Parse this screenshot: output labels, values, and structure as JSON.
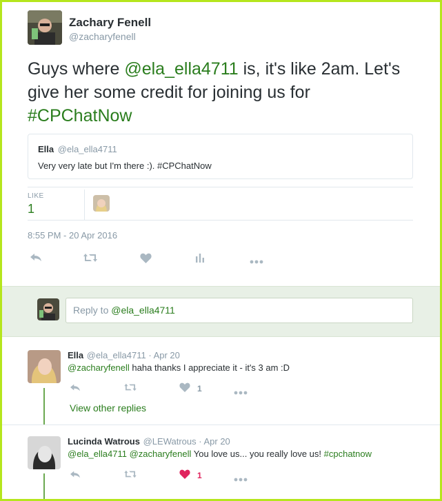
{
  "tweet": {
    "author_name": "Zachary Fenell",
    "author_handle": "@zacharyfenell",
    "text_before": "Guys where ",
    "mention": "@ela_ella4711",
    "text_middle": " is, it's like 2am. Let's give her some credit for joining us for ",
    "hashtag": "#CPChatNow",
    "timestamp": "8:55 PM - 20 Apr 2016",
    "likes_label": "LIKE",
    "likes_count": "1"
  },
  "quoted": {
    "name": "Ella",
    "handle": "@ela_ella4711",
    "text": "Very very late but I'm there :). #CPChatNow"
  },
  "reply_box": {
    "prefix": "Reply to ",
    "mention": "@ela_ella4711"
  },
  "replies": [
    {
      "name": "Ella",
      "handle": "@ela_ella4711",
      "date": "Apr 20",
      "mention": "@zacharyfenell",
      "text": " haha thanks I appreciate it - it's 3 am :D",
      "like_count": "1",
      "liked": false,
      "view_replies": "View other replies"
    },
    {
      "name": "Lucinda Watrous",
      "handle": "@LEWatrous",
      "date": "Apr 20",
      "mention1": "@ela_ella4711",
      "mention2": "@zacharyfenell",
      "text": " You love us... you really love us! ",
      "hashtag": "#cpchatnow",
      "like_count": "1",
      "liked": true
    }
  ],
  "icons": [
    "reply-icon",
    "retweet-icon",
    "heart-icon",
    "analytics-icon",
    "more-icon"
  ],
  "colors": {
    "frame": "#b5e61d",
    "link": "#2a7d1d",
    "muted": "#8899a6",
    "liked": "#e0245e",
    "reply_band": "#e8f0e6"
  }
}
